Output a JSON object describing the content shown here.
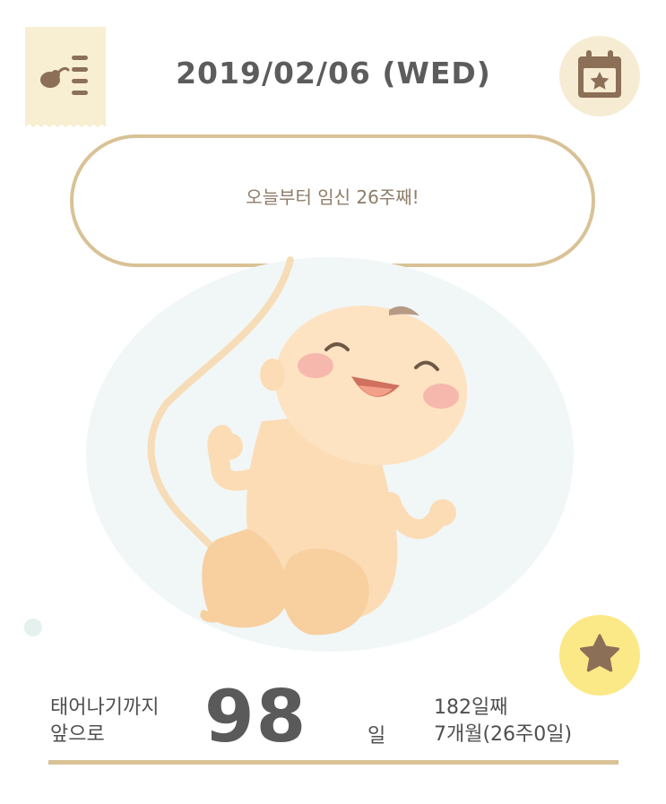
{
  "header": {
    "date": "2019/02/06 (WED)",
    "journal_icon": "journal-list-icon",
    "calendar_icon": "calendar-star-icon"
  },
  "bubble": {
    "message": "오늘부터 임신 26주째!"
  },
  "countdown": {
    "label_line1": "태어나기까지",
    "label_line2": "앞으로",
    "days_left": "98",
    "unit": "일",
    "day_count": "182일째",
    "month_week": "7개월(26주0일)"
  },
  "actions": {
    "star_icon": "star-icon"
  },
  "colors": {
    "accent_tan": "#d8c296",
    "bubble_border": "#d8c296",
    "star_bg": "#fbe887",
    "icon_brown": "#8c6f57",
    "text": "#5c5c5c"
  }
}
